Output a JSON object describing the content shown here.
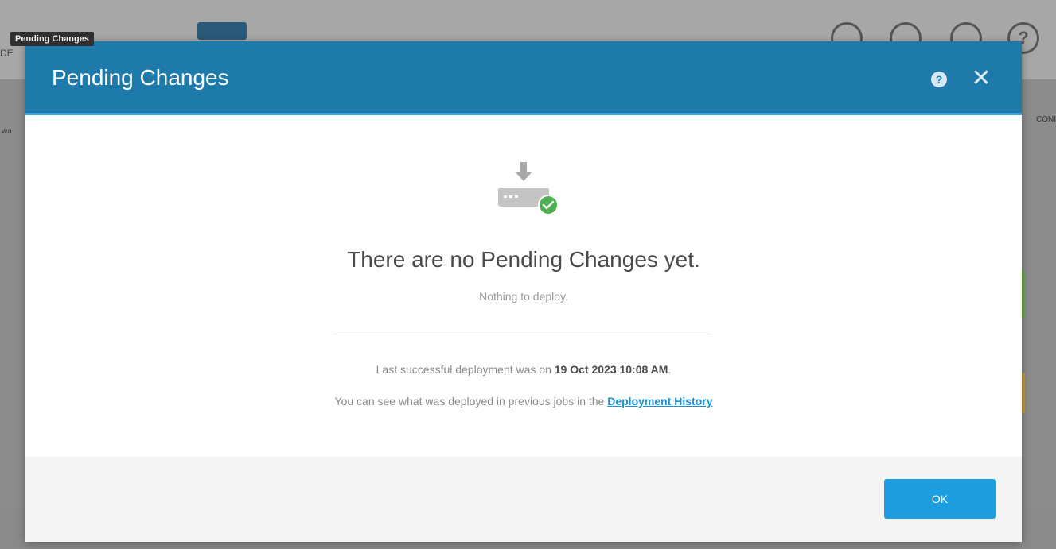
{
  "background": {
    "tooltip": "Pending Changes",
    "left_fragment": "DE",
    "right_edge_label": "CONI",
    "left_edge_label": "wa",
    "top_icons": [
      "refresh-icon",
      "upload-icon",
      "list-icon",
      "help-icon"
    ],
    "help_glyph": "?"
  },
  "dialog": {
    "title": "Pending Changes",
    "help_glyph": "?",
    "close_glyph": "✕",
    "empty_title": "There are no Pending Changes yet.",
    "empty_subtitle": "Nothing to deploy.",
    "last_deploy_prefix": "Last successful deployment was on ",
    "last_deploy_date": "19 Oct 2023 10:08 AM",
    "last_deploy_suffix": ".",
    "history_prefix": "You can see what was deployed in previous jobs in the ",
    "history_link": "Deployment History",
    "ok_label": "OK"
  },
  "colors": {
    "header": "#1e7aab",
    "accent_button": "#1d9ee0",
    "success": "#4caf50"
  }
}
